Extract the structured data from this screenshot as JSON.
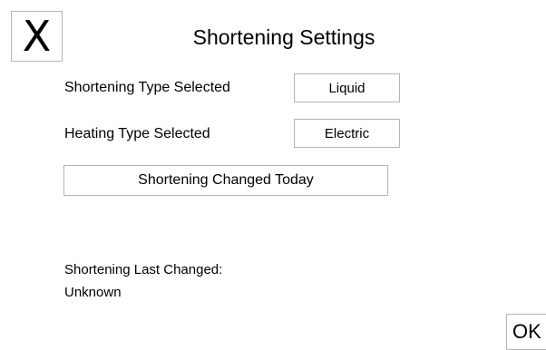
{
  "header": {
    "close_label": "X",
    "title": "Shortening Settings"
  },
  "settings": {
    "shortening_type_label": "Shortening Type Selected",
    "shortening_type_value": "Liquid",
    "heating_type_label": "Heating Type Selected",
    "heating_type_value": "Electric",
    "changed_today_button": "Shortening Changed Today"
  },
  "status": {
    "last_changed_label": "Shortening Last Changed:",
    "last_changed_value": "Unknown"
  },
  "footer": {
    "ok_label": "OK"
  }
}
